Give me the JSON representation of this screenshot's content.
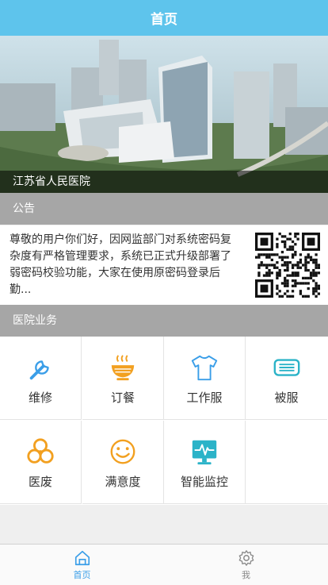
{
  "header": {
    "title": "首页"
  },
  "banner": {
    "caption": "江苏省人民医院"
  },
  "notice": {
    "section_title": "公告",
    "text": "尊敬的用户你们好，因网监部门对系统密码复杂度有严格管理要求，系统已正式升级部署了弱密码校验功能，大家在使用原密码登录后勤..."
  },
  "services": {
    "section_title": "医院业务",
    "items": [
      {
        "label": "维修",
        "icon": "wrench-icon",
        "color": "#3a9ee8"
      },
      {
        "label": "订餐",
        "icon": "bowl-icon",
        "color": "#f2a020"
      },
      {
        "label": "工作服",
        "icon": "tshirt-icon",
        "color": "#3a9ee8"
      },
      {
        "label": "被服",
        "icon": "bedding-icon",
        "color": "#2bb3c8"
      },
      {
        "label": "医废",
        "icon": "biohazard-icon",
        "color": "#f2a020"
      },
      {
        "label": "满意度",
        "icon": "smiley-icon",
        "color": "#f2a020"
      },
      {
        "label": "智能监控",
        "icon": "monitor-icon",
        "color": "#2bb3c8"
      }
    ]
  },
  "tabbar": {
    "items": [
      {
        "label": "首页",
        "icon": "home-icon",
        "active": true,
        "color": "#3a9ee8"
      },
      {
        "label": "我",
        "icon": "gear-icon",
        "active": false,
        "color": "#888888"
      }
    ]
  }
}
